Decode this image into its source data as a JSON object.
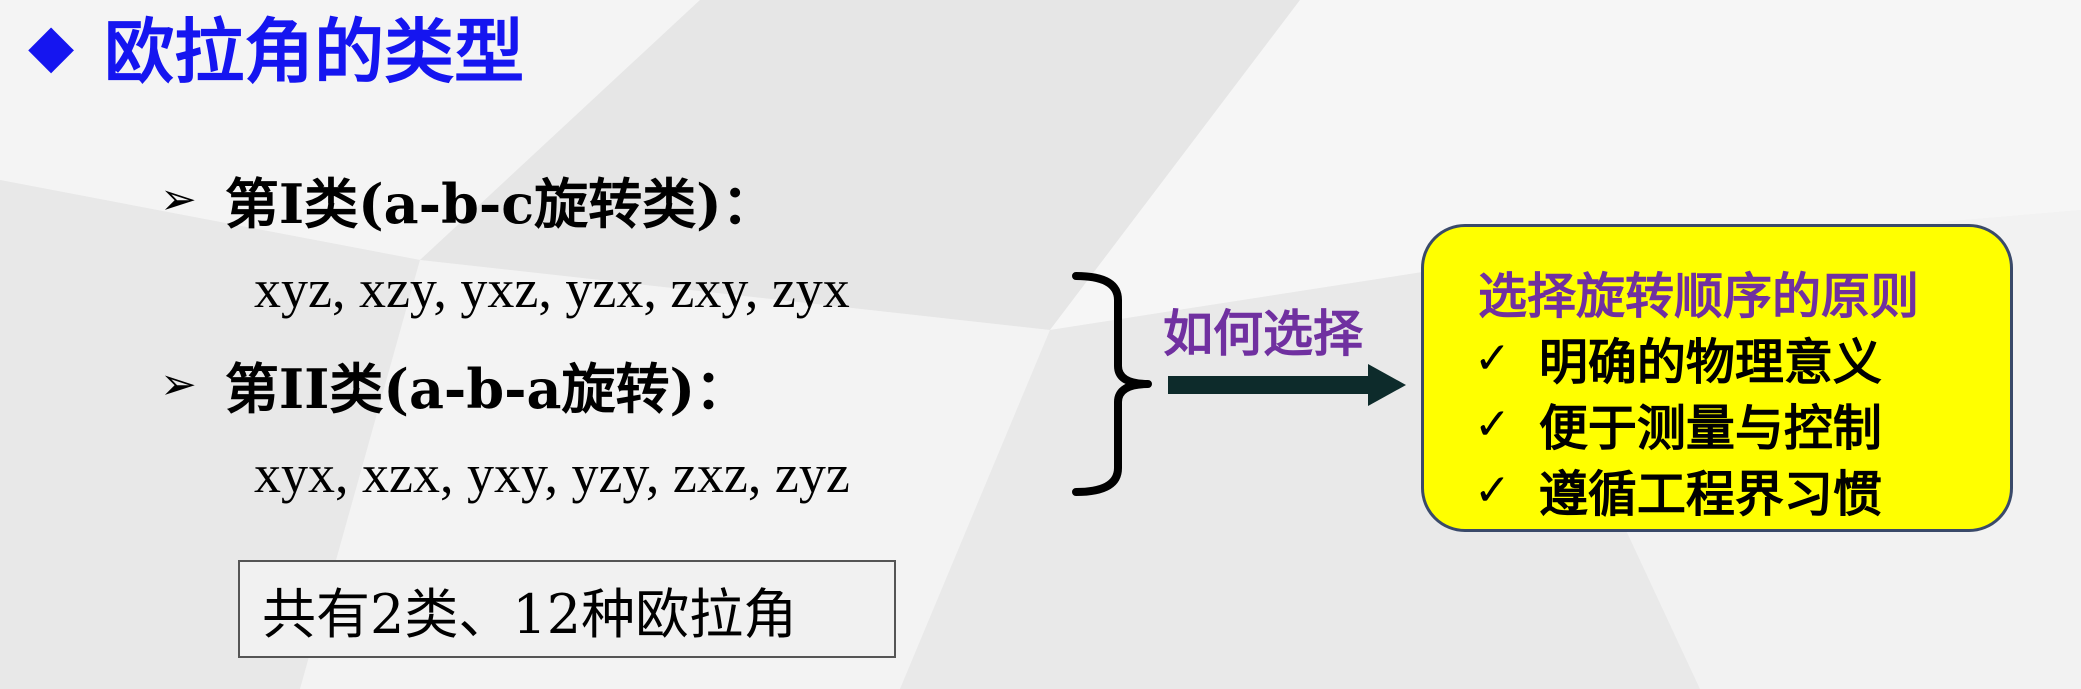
{
  "slide": {
    "title_marker": "◆",
    "title": "欧拉角的类型",
    "class1": {
      "marker": "➢",
      "label": "第I类(a-b-c旋转类)："
    },
    "class1_sequences": "xyz,  xzy,  yxz,  yzx,  zxy,  zyx",
    "class2": {
      "marker": "➢",
      "label": "第II类(a-b-a旋转)："
    },
    "class2_sequences": "xyx,  xzx,  yxy,  yzy,  zxz,  zyz",
    "how_to_choose": "如何选择",
    "principle": {
      "title": "选择旋转顺序的原则",
      "check_glyph": "✓",
      "items": [
        "明确的物理意义",
        "便于测量与控制",
        "遵循工程界习惯"
      ]
    },
    "summary": "共有2类、12种欧拉角"
  },
  "colors": {
    "title": "#1515f0",
    "accent_purple": "#7030a0",
    "box_fill": "#ffff00",
    "arrow": "#0d2b2b"
  }
}
